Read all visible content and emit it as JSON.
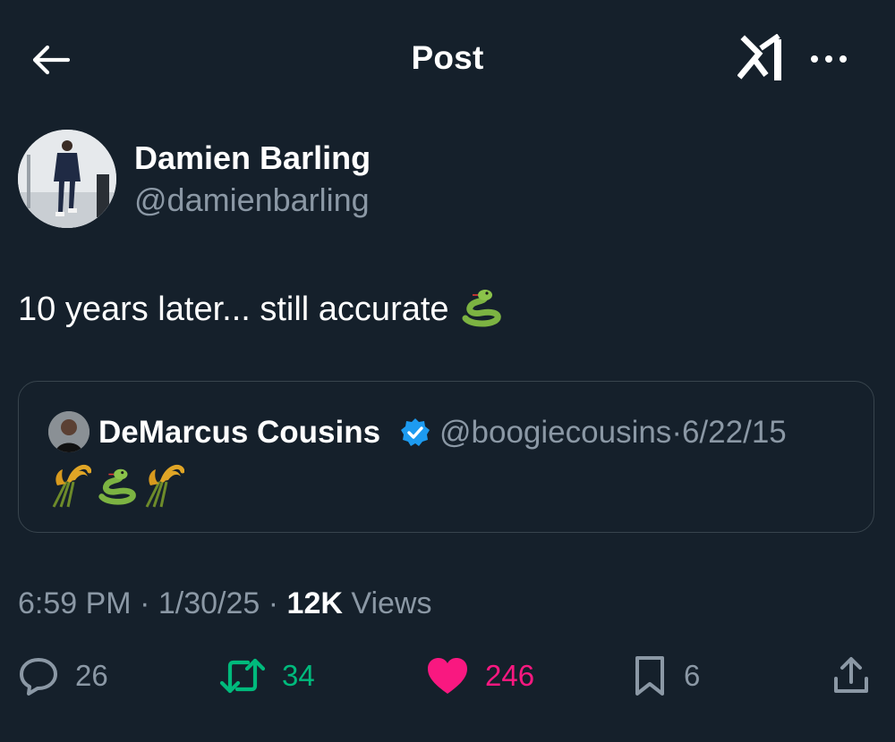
{
  "header": {
    "title": "Post",
    "back_icon": "arrow-left-icon",
    "grok_icon": "grok-icon",
    "more_icon": "more-horizontal-icon"
  },
  "author": {
    "name": "Damien Barling",
    "handle": "@damienbarling"
  },
  "post": {
    "text": "10 years later... still accurate",
    "emoji": "snake-emoji"
  },
  "quoted": {
    "name": "DeMarcus Cousins",
    "verified": true,
    "handle": "@boogiecousins",
    "separator": "·",
    "date": "6/22/15",
    "emojis": [
      "sheaf-of-rice-emoji",
      "snake-emoji",
      "sheaf-of-rice-emoji"
    ]
  },
  "meta": {
    "time": "6:59 PM",
    "date": "1/30/25",
    "views_count": "12K",
    "views_label": "Views",
    "separator": "·"
  },
  "actions": {
    "replies": "26",
    "reposts": "34",
    "likes": "246",
    "bookmarks": "6"
  },
  "colors": {
    "background": "#15202b",
    "secondary_text": "#8b98a5",
    "border": "#38444d",
    "repost": "#00ba7c",
    "like": "#f91880",
    "verified": "#1d9bf0"
  }
}
